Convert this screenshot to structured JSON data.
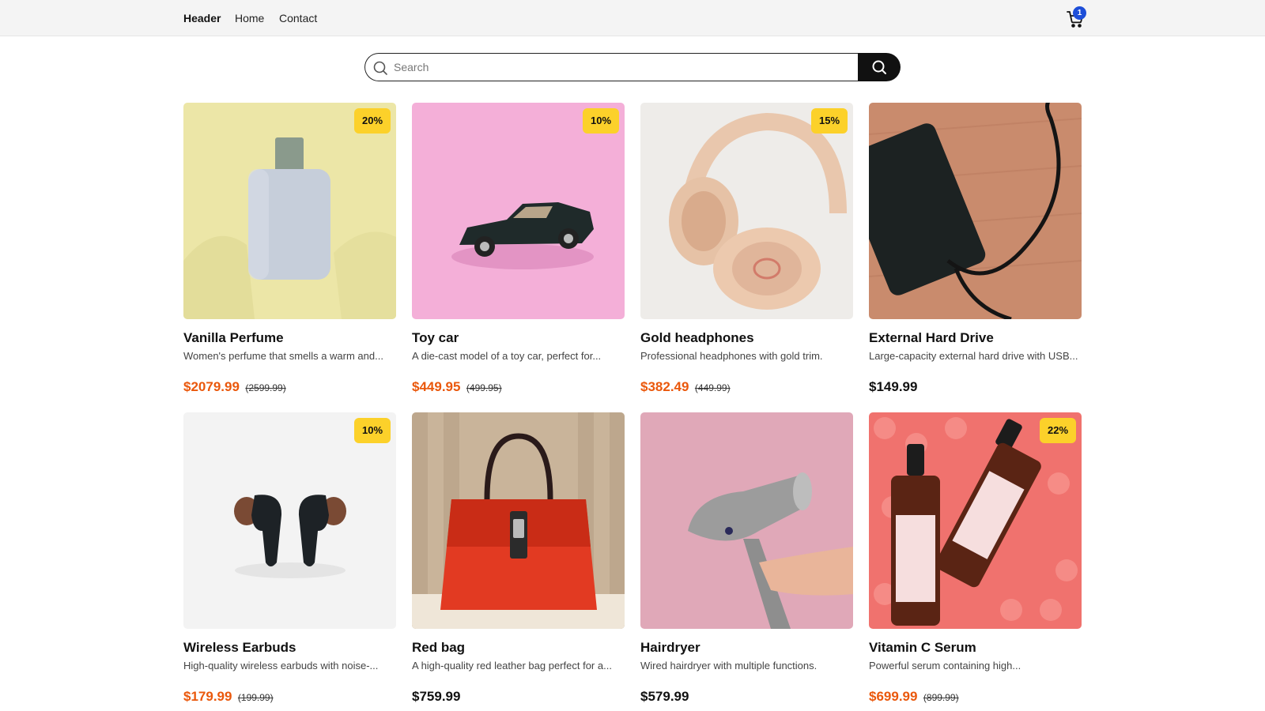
{
  "header": {
    "brand": "Header",
    "nav": [
      "Home",
      "Contact"
    ],
    "cart_count": "1",
    "cart_icon": "shopping-cart-icon",
    "badge_color": "#1d4ed8"
  },
  "search": {
    "placeholder": "Search",
    "value": "",
    "icon": "search-icon"
  },
  "colors": {
    "sale_price": "#ea580c",
    "discount_badge": "#fcd12a",
    "search_button": "#111111"
  },
  "products": [
    {
      "title": "Vanilla Perfume",
      "desc": "Women's perfume that smells a warm and...",
      "price": "$2079.99",
      "original": "(2599.99)",
      "discount": "20%"
    },
    {
      "title": "Toy car",
      "desc": "A die-cast model of a toy car, perfect for...",
      "price": "$449.95",
      "original": "(499.95)",
      "discount": "10%"
    },
    {
      "title": "Gold headphones",
      "desc": "Professional headphones with gold trim.",
      "price": "$382.49",
      "original": "(449.99)",
      "discount": "15%"
    },
    {
      "title": "External Hard Drive",
      "desc": "Large-capacity external hard drive with USB...",
      "price": "$149.99",
      "original": "",
      "discount": ""
    },
    {
      "title": "Wireless Earbuds",
      "desc": "High-quality wireless earbuds with noise-...",
      "price": "$179.99",
      "original": "(199.99)",
      "discount": "10%"
    },
    {
      "title": "Red bag",
      "desc": "A high-quality red leather bag perfect for a...",
      "price": "$759.99",
      "original": "",
      "discount": ""
    },
    {
      "title": "Hairdryer",
      "desc": "Wired hairdryer with multiple functions.",
      "price": "$579.99",
      "original": "",
      "discount": ""
    },
    {
      "title": "Vitamin C Serum",
      "desc": "Powerful serum containing high...",
      "price": "$699.99",
      "original": "(899.99)",
      "discount": "22%"
    }
  ]
}
